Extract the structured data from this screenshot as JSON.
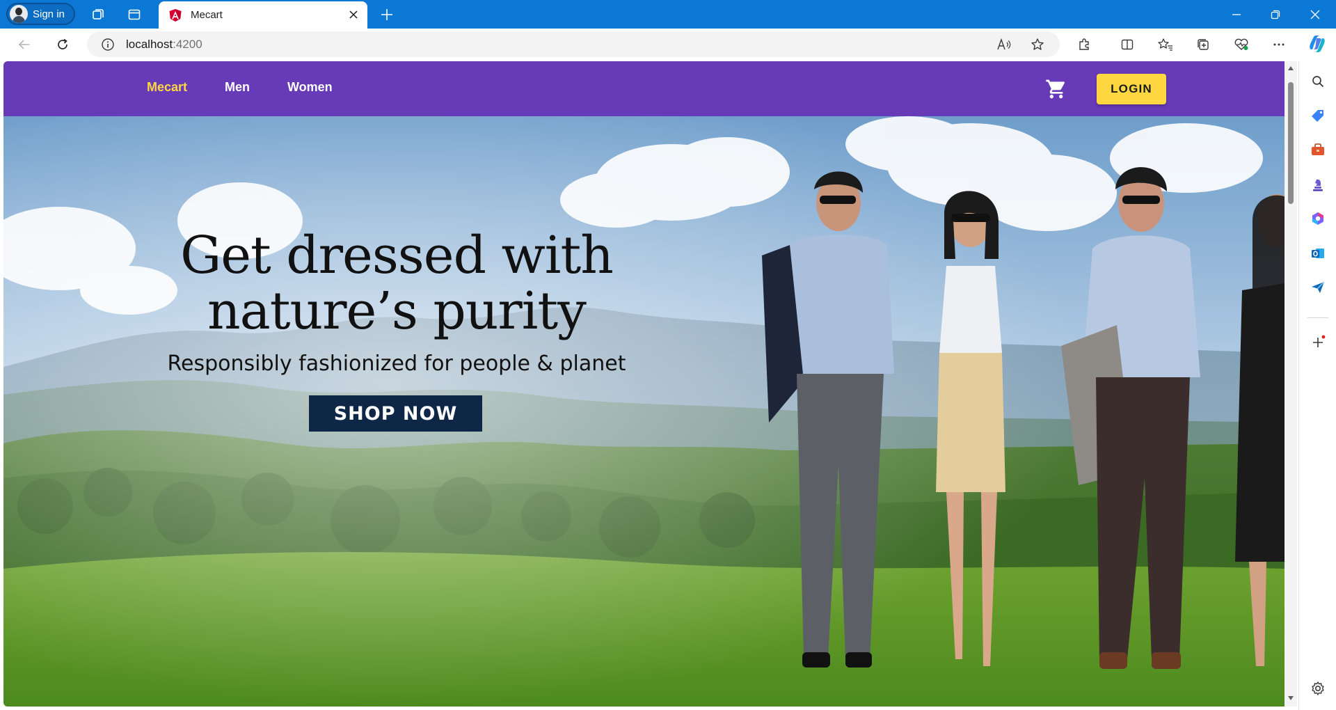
{
  "browser": {
    "profile_label": "Sign in",
    "tab_title": "Mecart",
    "url_host": "localhost",
    "url_port": ":4200"
  },
  "app": {
    "brand": "Mecart",
    "nav": [
      "Men",
      "Women"
    ],
    "login_label": "LOGIN",
    "theme": {
      "primary": "#673ab7",
      "accent": "#ffd740"
    }
  },
  "hero": {
    "headline_line1": "Get dressed with",
    "headline_line2": "nature’s purity",
    "subtitle": "Responsibly fashionized for people & planet",
    "cta_label": "SHOP NOW"
  }
}
